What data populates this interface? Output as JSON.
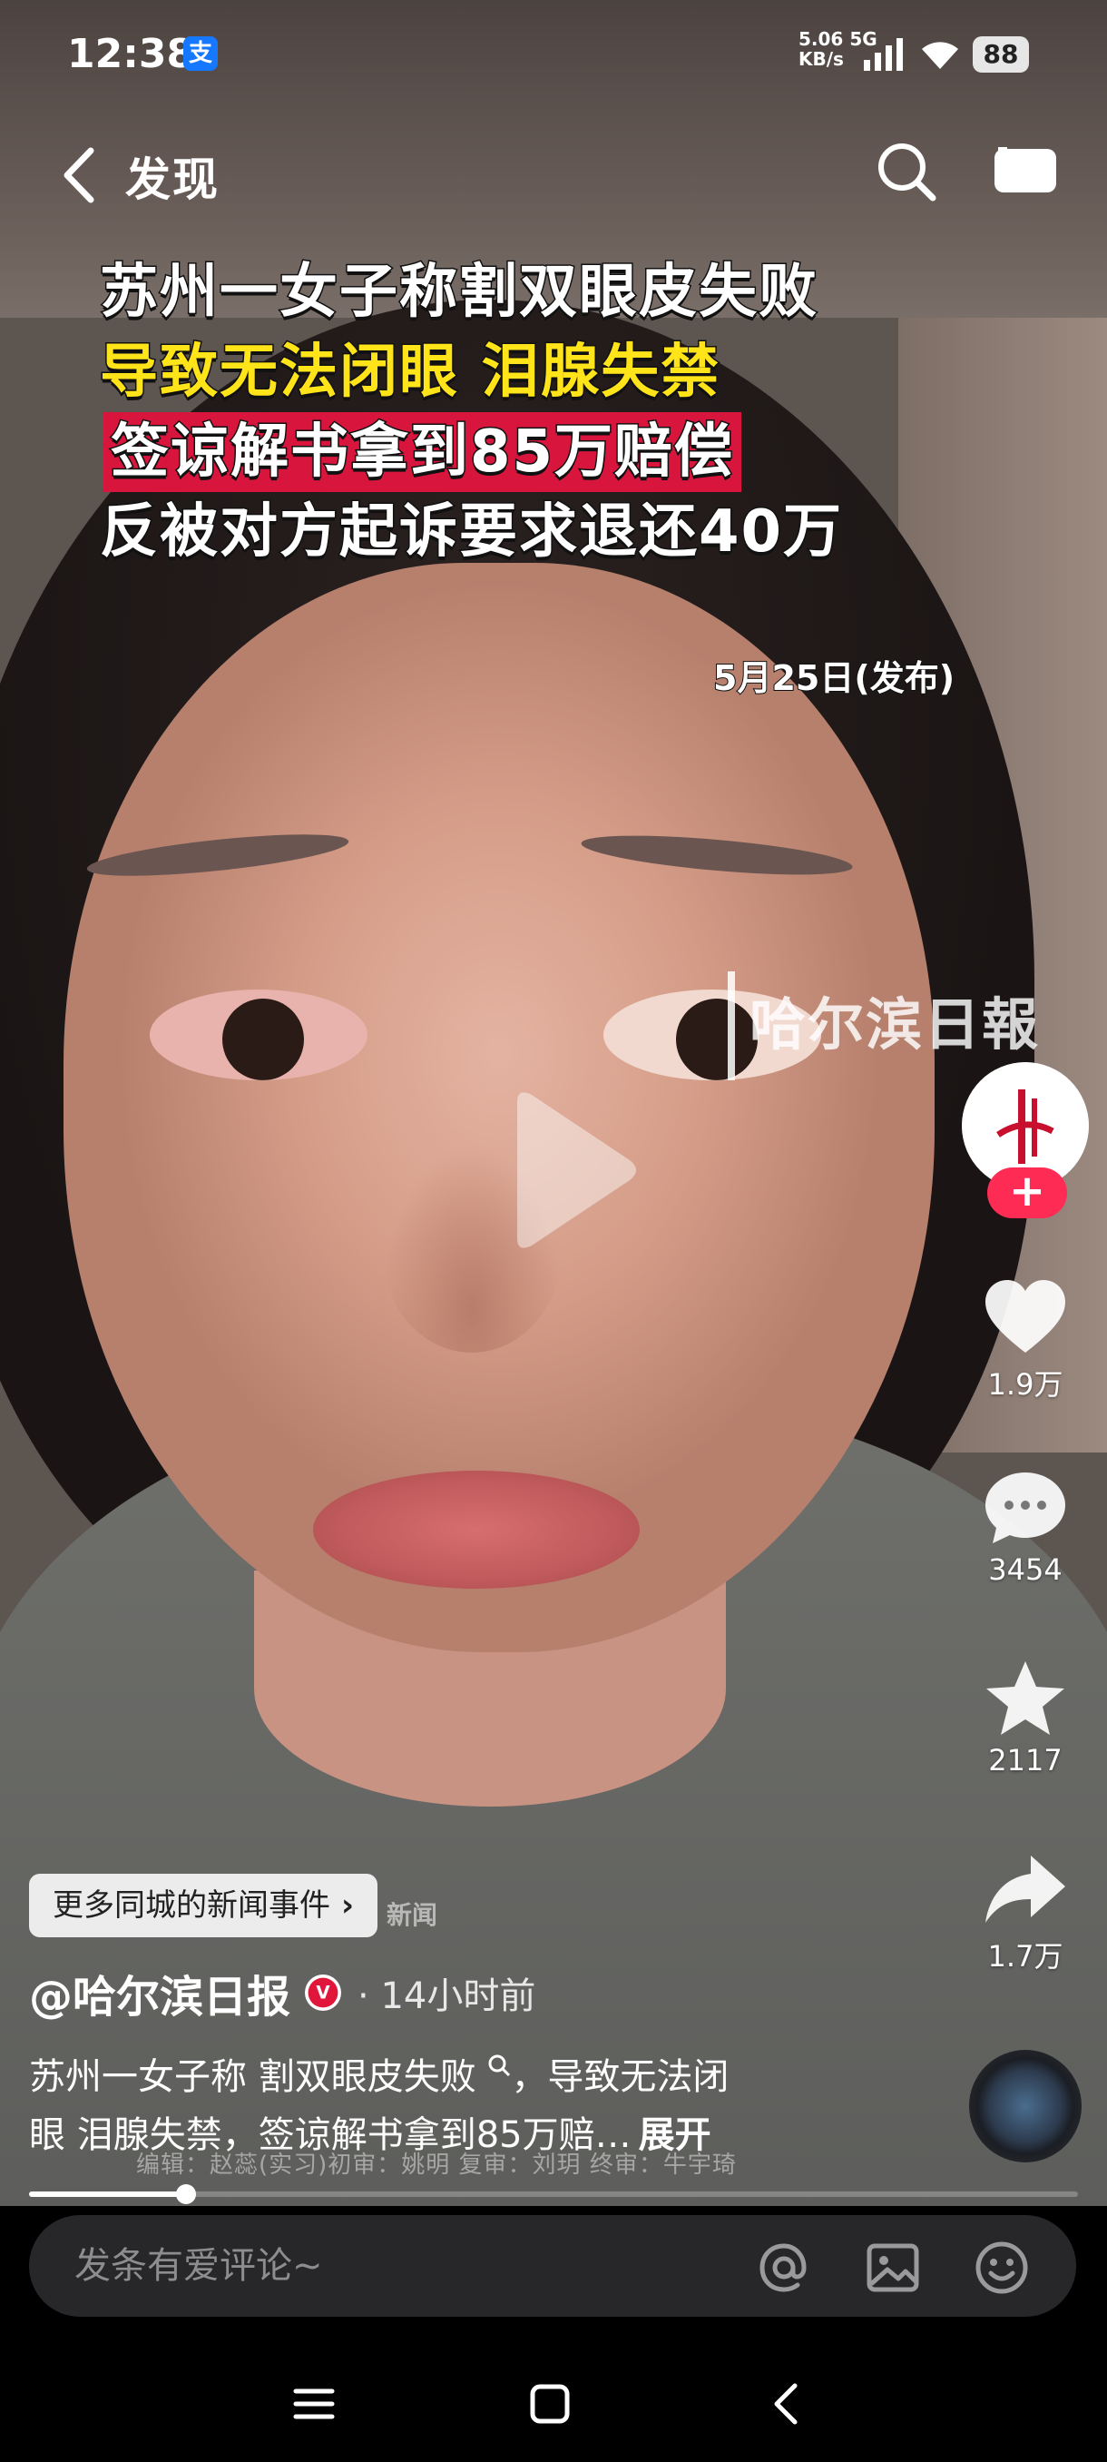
{
  "status_bar": {
    "time": "12:38",
    "app_icon_glyph": "支",
    "net_speed": "5.06",
    "net_unit": "KB/s",
    "net_type": "5G",
    "battery": "88"
  },
  "top_bar": {
    "title": "发现"
  },
  "video_overlay": {
    "headline_lines": [
      "苏州一女子称割双眼皮失败",
      "导致无法闭眼  泪腺失禁",
      "签谅解书拿到85万赔偿",
      "反被对方起诉要求退还40万"
    ],
    "date_caption": "5月25日(发布)",
    "watermark": "哈尔滨日報",
    "watermark_partial": "新闻",
    "credits": "编辑：赵蕊(实习)初审：姚明   复审：刘玥  终审：牛宇琦"
  },
  "right_rail": {
    "follow_symbol": "+",
    "likes": "1.9万",
    "comments": "3454",
    "favorites": "2117",
    "shares": "1.7万"
  },
  "info": {
    "tag_chip": "更多同城的新闻事件",
    "tag_chip_arrow": "›",
    "author": "@哈尔滨日报",
    "time_ago": "· 14小时前",
    "desc_line1": "苏州一女子称 割双眼皮失败",
    "desc_line1_rest": "，导致无法闭",
    "desc_line2": "眼 泪腺失禁，签谅解书拿到85万赔…",
    "desc_expand": "展开",
    "progress": 0.15
  },
  "comment_bar": {
    "placeholder": "发条有爱评论~"
  },
  "colors": {
    "accent_red": "#fe2c55",
    "headline_yellow": "#ffe41a",
    "headline_red_bg": "#d8153d"
  }
}
